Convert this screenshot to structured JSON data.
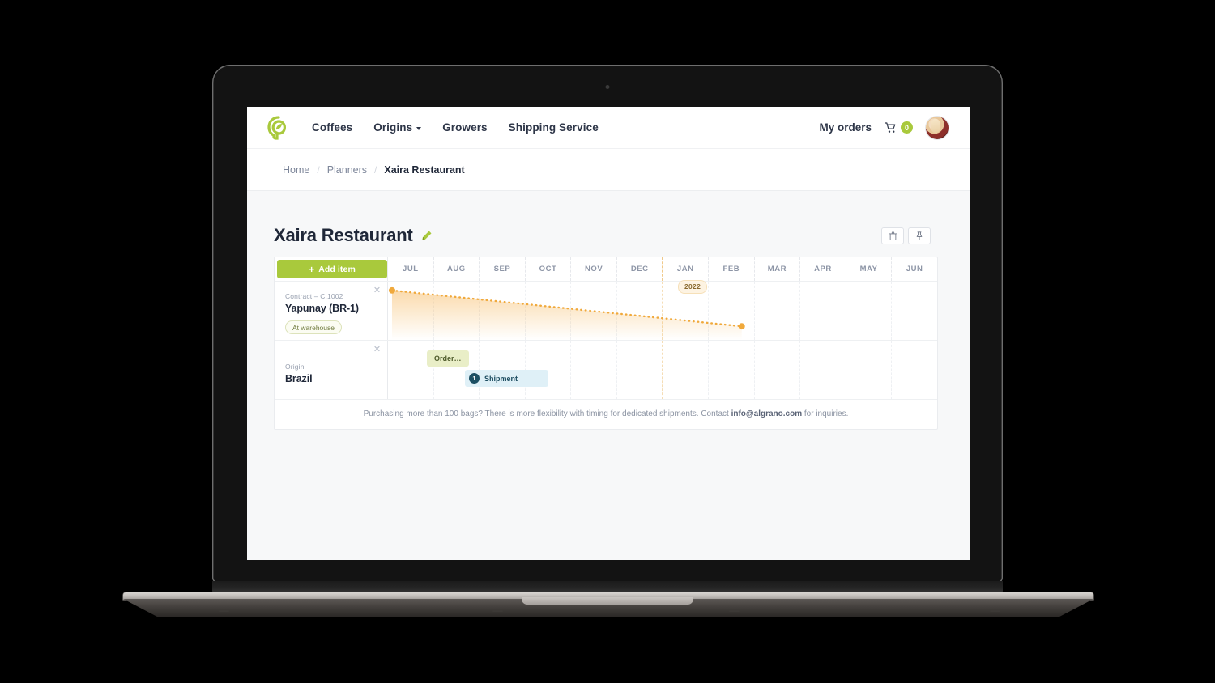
{
  "navbar": {
    "logo_icon": "algrano-leaf-logo",
    "links": [
      {
        "label": "Coffees",
        "has_caret": false
      },
      {
        "label": "Origins",
        "has_caret": true
      },
      {
        "label": "Growers",
        "has_caret": false
      },
      {
        "label": "Shipping Service",
        "has_caret": false
      }
    ],
    "my_orders": "My orders",
    "cart_icon": "shopping-cart-icon",
    "cart_count": "0",
    "avatar_icon": "user-avatar"
  },
  "breadcrumb": {
    "items": [
      "Home",
      "Planners",
      "Xaira Restaurant"
    ],
    "separator": "/"
  },
  "page": {
    "title": "Xaira Restaurant",
    "edit_icon": "pencil-edit-icon",
    "actions": [
      {
        "name": "delete-planner-button",
        "icon": "trash-icon"
      },
      {
        "name": "pin-planner-button",
        "icon": "pin-icon"
      }
    ]
  },
  "planner": {
    "add_item_label": "Add item",
    "add_item_plus": "+",
    "months": [
      "JUL",
      "AUG",
      "SEP",
      "OCT",
      "NOV",
      "DEC",
      "JAN",
      "FEB",
      "MAR",
      "APR",
      "MAY",
      "JUN"
    ],
    "year_badge": "2022",
    "year_boundary_after": "DEC",
    "rows": [
      {
        "kicker": "Contract – C.1002",
        "title": "Yapunay (BR-1)",
        "badge": "At warehouse",
        "close_icon": "close-icon",
        "type": "contract-curve"
      },
      {
        "kicker": "Origin",
        "title": "Brazil",
        "close_icon": "close-icon",
        "type": "origin-bars",
        "bars": [
          {
            "label": "Order…",
            "kind": "order"
          },
          {
            "label": "Shipment",
            "count": "1",
            "kind": "shipment"
          }
        ]
      }
    ],
    "footer_text_before": "Purchasing more than 100 bags? There is more flexibility with timing for dedicated shipments. Contact ",
    "footer_email": "info@algrano.com",
    "footer_text_after": " for inquiries."
  },
  "chart_data": {
    "type": "line",
    "title": "Contract C.1002 stock depletion",
    "x": [
      "JUL",
      "AUG",
      "SEP",
      "OCT",
      "NOV",
      "DEC",
      "JAN",
      "FEB",
      "MAR"
    ],
    "series": [
      {
        "name": "Yapunay (BR-1) stock",
        "values": [
          100,
          93,
          86,
          79,
          72,
          65,
          58,
          51,
          44
        ]
      }
    ],
    "line_style": "dotted",
    "line_color": "#f0a93c",
    "fill": "gradient-orange-to-transparent",
    "markers": [
      "start",
      "end"
    ],
    "grid": true,
    "legend": "none",
    "xlabel": "",
    "ylabel": ""
  },
  "colors": {
    "brand_green": "#a9c93c",
    "orange_line": "#f0a93c",
    "year_badge_bg": "#fdf3e2",
    "order_bar": "#e9eec7",
    "shipment_bar": "#dff0f7",
    "shipment_dot": "#1c4f63",
    "text_dark": "#1f2738",
    "text_muted": "#8d95a6",
    "page_bg": "#f7f8f9"
  }
}
